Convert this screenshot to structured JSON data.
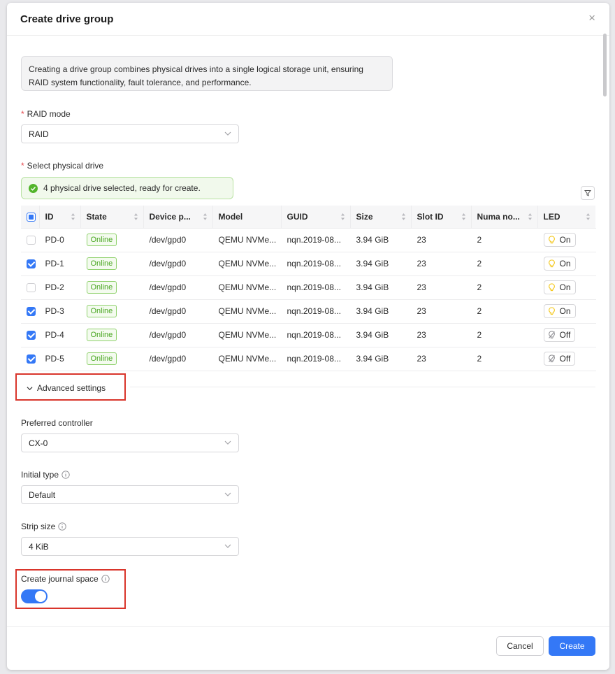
{
  "dialog": {
    "title": "Create drive group",
    "close_label": "×",
    "info_text": "Creating a drive group combines physical drives into a single logical storage unit, ensuring RAID system functionality, fault tolerance, and performance."
  },
  "raid_mode": {
    "required_mark": "*",
    "label": "RAID mode",
    "value": "RAID"
  },
  "physical_drive": {
    "required_mark": "*",
    "label": "Select physical drive",
    "status_text": "4 physical drive selected, ready for create.",
    "columns": [
      "ID",
      "State",
      "Device p...",
      "Model",
      "GUID",
      "Size",
      "Slot ID",
      "Numa no...",
      "LED"
    ],
    "rows": [
      {
        "checked": false,
        "id": "PD-0",
        "state": "Online",
        "device": "/dev/gpd0",
        "model": "QEMU NVMe...",
        "guid": "nqn.2019-08...",
        "size": "3.94 GiB",
        "slot": "23",
        "numa": "2",
        "led": "On",
        "led_icon": "bulb-icon"
      },
      {
        "checked": true,
        "id": "PD-1",
        "state": "Online",
        "device": "/dev/gpd0",
        "model": "QEMU NVMe...",
        "guid": "nqn.2019-08...",
        "size": "3.94 GiB",
        "slot": "23",
        "numa": "2",
        "led": "On",
        "led_icon": "bulb-icon"
      },
      {
        "checked": false,
        "id": "PD-2",
        "state": "Online",
        "device": "/dev/gpd0",
        "model": "QEMU NVMe...",
        "guid": "nqn.2019-08...",
        "size": "3.94 GiB",
        "slot": "23",
        "numa": "2",
        "led": "On",
        "led_icon": "bulb-icon"
      },
      {
        "checked": true,
        "id": "PD-3",
        "state": "Online",
        "device": "/dev/gpd0",
        "model": "QEMU NVMe...",
        "guid": "nqn.2019-08...",
        "size": "3.94 GiB",
        "slot": "23",
        "numa": "2",
        "led": "On",
        "led_icon": "bulb-icon"
      },
      {
        "checked": true,
        "id": "PD-4",
        "state": "Online",
        "device": "/dev/gpd0",
        "model": "QEMU NVMe...",
        "guid": "nqn.2019-08...",
        "size": "3.94 GiB",
        "slot": "23",
        "numa": "2",
        "led": "Off",
        "led_icon": "bulb-off-icon"
      },
      {
        "checked": true,
        "id": "PD-5",
        "state": "Online",
        "device": "/dev/gpd0",
        "model": "QEMU NVMe...",
        "guid": "nqn.2019-08...",
        "size": "3.94 GiB",
        "slot": "23",
        "numa": "2",
        "led": "Off",
        "led_icon": "bulb-off-icon"
      }
    ]
  },
  "advanced": {
    "toggle_label": "Advanced settings",
    "preferred_controller": {
      "label": "Preferred controller",
      "value": "CX-0"
    },
    "initial_type": {
      "label": "Initial type",
      "value": "Default"
    },
    "strip_size": {
      "label": "Strip size",
      "value": "4 KiB"
    },
    "journal_space": {
      "label": "Create journal space",
      "enabled": true
    }
  },
  "footer": {
    "cancel_label": "Cancel",
    "create_label": "Create"
  },
  "colors": {
    "primary": "#3478f6",
    "online_green": "#4aa723",
    "highlight_red": "#d9352b",
    "bulb_yellow": "#f3c614"
  }
}
